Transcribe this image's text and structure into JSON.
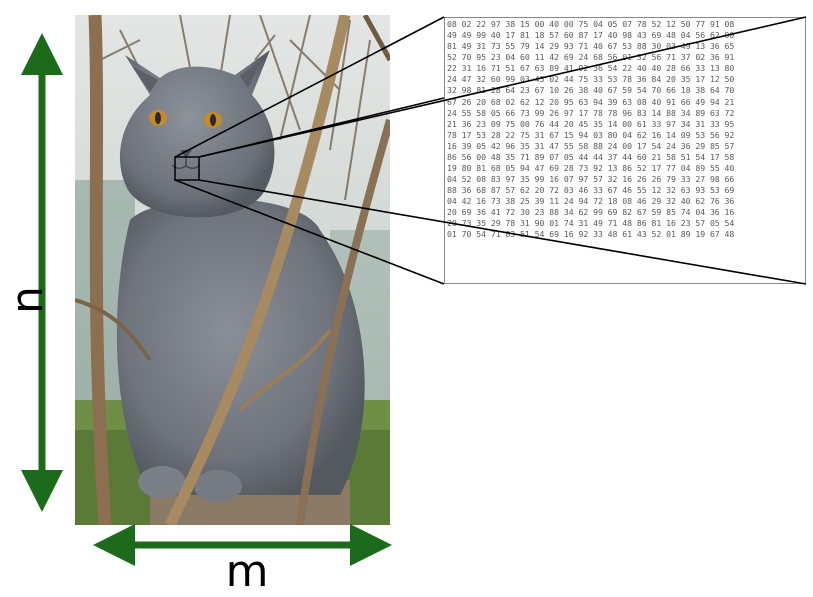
{
  "labels": {
    "height": "n",
    "width": "m"
  },
  "colors": {
    "arrow": "#1b6b1b",
    "zoom_lines": "#000000"
  },
  "pixel_values": [
    "08 02 22 97 38 15 00 40 00 75 04 05 07 78 52 12 50 77 91 08",
    "49 49 99 40 17 81 18 57 60 87 17 40 98 43 69 48 04 56 62 00",
    "81 49 31 73 55 79 14 29 93 71 40 67 53 88 30 03 49 13 36 65",
    "52 70 95 23 04 60 11 42 69 24 68 56 01 32 56 71 37 02 36 91",
    "22 31 16 71 51 67 63 89 41 92 36 54 22 40 40 28 66 33 13 80",
    "24 47 32 60 99 03 45 02 44 75 33 53 78 36 84 20 35 17 12 50",
    "32 98 81 28 64 23 67 10 26 38 40 67 59 54 70 66 18 38 64 70",
    "67 26 20 68 02 62 12 20 95 63 94 39 63 08 40 91 66 49 94 21",
    "24 55 58 05 66 73 99 26 97 17 78 78 96 83 14 88 34 89 63 72",
    "21 36 23 09 75 00 76 44 20 45 35 14 00 61 33 97 34 31 33 95",
    "78 17 53 28 22 75 31 67 15 94 03 80 04 62 16 14 09 53 56 92",
    "16 39 05 42 96 35 31 47 55 58 88 24 00 17 54 24 36 29 85 57",
    "86 56 00 48 35 71 89 07 05 44 44 37 44 60 21 58 51 54 17 58",
    "19 80 81 68 05 94 47 69 28 73 92 13 86 52 17 77 04 89 55 40",
    "04 52 08 83 97 35 99 16 07 97 57 32 16 26 26 79 33 27 98 66",
    "88 36 68 87 57 62 20 72 03 46 33 67 46 55 12 32 63 93 53 69",
    "04 42 16 73 38 25 39 11 24 94 72 18 08 46 29 32 40 62 76 36",
    "20 69 36 41 72 30 23 88 34 62 99 69 82 67 59 85 74 04 36 16",
    "20 73 35 29 78 31 90 01 74 31 49 71 48 86 81 16 23 57 05 54",
    "01 70 54 71 83 51 54 69 16 92 33 48 61 43 52 01 89 19 67 48"
  ]
}
